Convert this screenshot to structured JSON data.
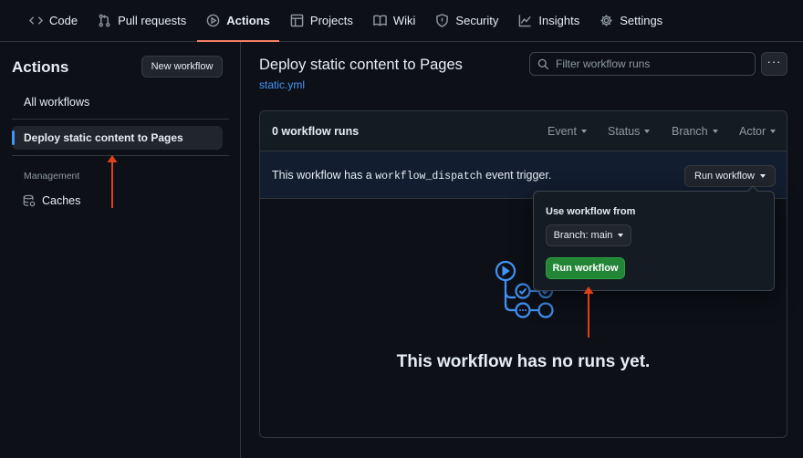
{
  "topnav": {
    "items": [
      {
        "label": "Code",
        "icon": "code-icon"
      },
      {
        "label": "Pull requests",
        "icon": "pull-request-icon"
      },
      {
        "label": "Actions",
        "icon": "play-icon",
        "active": true
      },
      {
        "label": "Projects",
        "icon": "table-icon"
      },
      {
        "label": "Wiki",
        "icon": "book-icon"
      },
      {
        "label": "Security",
        "icon": "shield-icon"
      },
      {
        "label": "Insights",
        "icon": "graph-icon"
      },
      {
        "label": "Settings",
        "icon": "gear-icon"
      }
    ]
  },
  "sidebar": {
    "title": "Actions",
    "new_workflow_label": "New workflow",
    "all_workflows": "All workflows",
    "selected_workflow": "Deploy static content to Pages",
    "management_heading": "Management",
    "caches_label": "Caches"
  },
  "main": {
    "title": "Deploy static content to Pages",
    "file": "static.yml",
    "filter_placeholder": "Filter workflow runs",
    "kebab": "···",
    "runs_count": "0 workflow runs",
    "filters": [
      "Event",
      "Status",
      "Branch",
      "Actor"
    ],
    "dispatch": {
      "prefix": "This workflow has a",
      "code": "workflow_dispatch",
      "suffix": "event trigger."
    },
    "run_workflow_label": "Run workflow",
    "empty_message": "This workflow has no runs yet."
  },
  "popover": {
    "label": "Use workflow from",
    "branch_label": "Branch: main",
    "run_label": "Run workflow"
  },
  "colors": {
    "background": "#0d1117",
    "accent_tab": "#f78166",
    "link": "#4493f8",
    "run_button": "#238636",
    "annotation_arrow": "#e0401a"
  }
}
